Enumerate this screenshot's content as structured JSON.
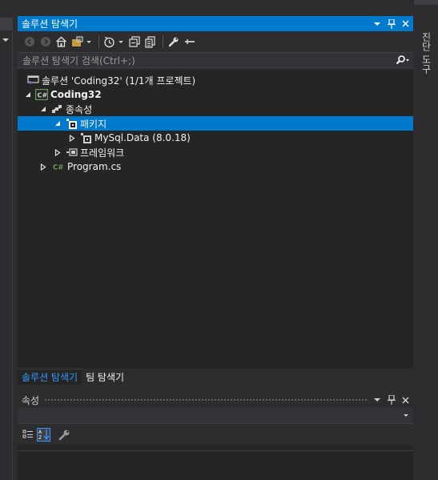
{
  "solution_explorer": {
    "title": "솔루션 탐색기",
    "search_placeholder": "솔루션 탐색기 검색(Ctrl+;)",
    "tree": {
      "solution": "솔루션 'Coding32' (1/1개 프로젝트)",
      "project": "Coding32",
      "dependencies": "종속성",
      "packages": "패키지",
      "package_mysql": "MySql.Data (8.0.18)",
      "frameworks": "프레임워크",
      "program_file": "Program.cs"
    },
    "bottom_tabs": [
      "솔루션 탐색기",
      "팀 탐색기"
    ]
  },
  "properties": {
    "title": "속성"
  },
  "right_strip": {
    "vertical_tab": "진단 도구"
  },
  "colors": {
    "accent": "#007acc",
    "panel_bg": "#252526",
    "chrome_bg": "#2d2d30",
    "csharp_green": "#6a9955",
    "solution_purple": "#8a6ccf"
  }
}
